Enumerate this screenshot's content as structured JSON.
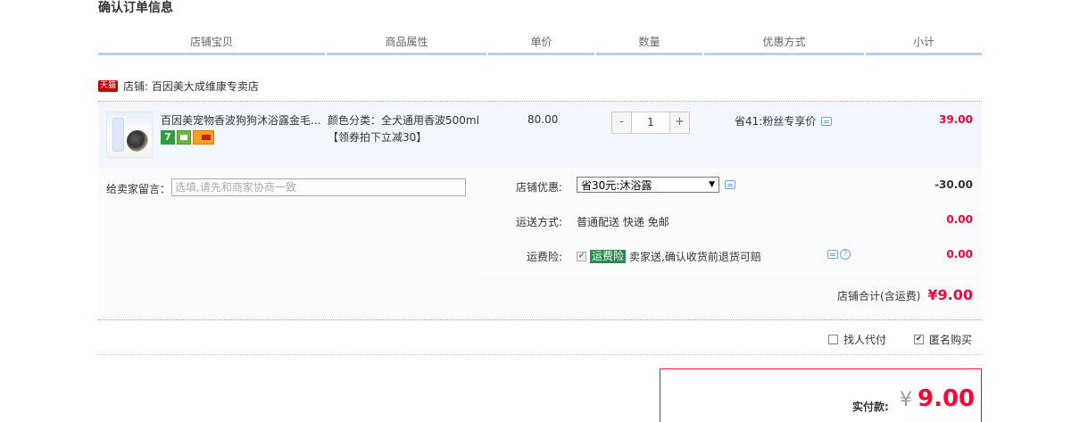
{
  "page_title": "确认订单信息",
  "table_headers": [
    "店铺宝贝",
    "商品属性",
    "单价",
    "数量",
    "优惠方式",
    "小计"
  ],
  "shop": {
    "badge": "天猫",
    "label": "店铺: 百因美大成维康专卖店"
  },
  "item": {
    "name": "百因美宠物香波狗狗沐浴露金毛...",
    "attr_line1": "颜色分类：全犬通用香波500ml",
    "attr_line2": "【领券拍下立减30】",
    "price": "80.00",
    "qty_minus": "-",
    "quantity": "1",
    "qty_plus": "+",
    "discount": "省41:粉丝专享价",
    "subtotal": "39.00",
    "icons": [
      "seven-day-return-icon",
      "calendar-icon",
      "credit-card-icon"
    ]
  },
  "message": {
    "label": "给卖家留言：",
    "placeholder": "选填,请先和商家协商一致"
  },
  "shop_discount": {
    "label": "店铺优惠:",
    "selected": "省30元:沐浴露",
    "amount": "-30.00"
  },
  "shipping": {
    "label": "运送方式:",
    "value": "普通配送 快递 免邮",
    "amount": "0.00"
  },
  "insurance": {
    "label": "运费险:",
    "badge": "运费险",
    "text": "卖家送,确认收货前退货可赔",
    "amount": "0.00",
    "checked": true
  },
  "shop_total": {
    "label": "店铺合计(含运费)",
    "value": "¥9.00"
  },
  "options": {
    "proxy_pay": "找人代付",
    "anonymous": "匿名购买",
    "proxy_checked": false,
    "anonymous_checked": true
  },
  "payment": {
    "label": "实付款:",
    "currency": "¥",
    "value": "9.00"
  },
  "colors": {
    "accent_red": "#ff0036",
    "header_rule": "#b2d1ff",
    "row_bg": "#f2f7ff",
    "insurance_green": "#2b8a48"
  }
}
